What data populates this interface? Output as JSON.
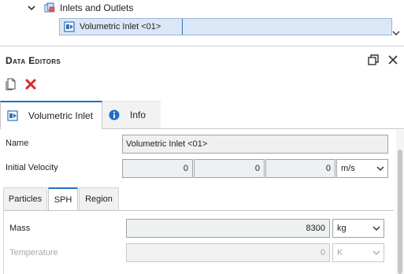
{
  "tree": {
    "parent_label": "Inlets and Outlets",
    "selected_label": "Volumetric Inlet <01>"
  },
  "panel": {
    "title": "Data Editors"
  },
  "tabs": [
    {
      "label": "Volumetric Inlet",
      "icon": "volumetric-inlet-icon",
      "active": true
    },
    {
      "label": "Info",
      "icon": "info-icon",
      "active": false
    }
  ],
  "form": {
    "name_label": "Name",
    "name_value": "Volumetric Inlet <01>",
    "initial_velocity_label": "Initial Velocity",
    "velocity": [
      "0",
      "0",
      "0"
    ],
    "velocity_unit": "m/s"
  },
  "subtabs": [
    {
      "label": "Particles",
      "active": false
    },
    {
      "label": "SPH",
      "active": true
    },
    {
      "label": "Region",
      "active": false
    }
  ],
  "sph": {
    "mass_label": "Mass",
    "mass_value": "8300",
    "mass_unit": "kg",
    "temperature_label": "Temperature",
    "temperature_value": "0",
    "temperature_unit": "K"
  },
  "colors": {
    "accent": "#1f6fc5",
    "selection_bg": "#dbe7f6",
    "delete_red": "#d9262c",
    "field_bg": "#eef0f1"
  }
}
